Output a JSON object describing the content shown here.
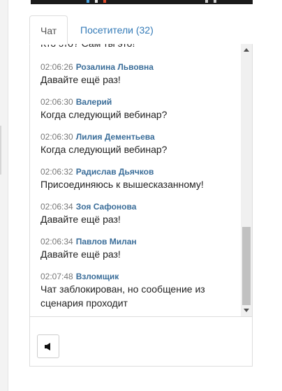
{
  "tabs": {
    "chat": "Чат",
    "visitors": "Посетители (32)"
  },
  "chat": {
    "partial_top_text": "Кто это? Сам ты это!",
    "messages": [
      {
        "time": "02:06:26",
        "author": "Розалина Львовна",
        "text": "Давайте ещё раз!"
      },
      {
        "time": "02:06:30",
        "author": "Валерий",
        "text": "Когда следующий вебинар?"
      },
      {
        "time": "02:06:30",
        "author": "Лилия Дементьева",
        "text": "Когда следующий вебинар?"
      },
      {
        "time": "02:06:32",
        "author": "Радислав Дьячков",
        "text": "Присоединяюсь к вышесказанному!"
      },
      {
        "time": "02:06:34",
        "author": "Зоя Сафонова",
        "text": "Давайте ещё раз!"
      },
      {
        "time": "02:06:34",
        "author": "Павлов Милан",
        "text": "Давайте ещё раз!"
      },
      {
        "time": "02:07:48",
        "author": "Взломщик",
        "text": "Чат заблокирован, но сообщение из сценария проходит"
      }
    ]
  },
  "controls": {
    "sound_icon": "speaker-icon"
  },
  "colors": {
    "link": "#337ab7",
    "author": "#3a6d99",
    "border": "#dddddd"
  }
}
